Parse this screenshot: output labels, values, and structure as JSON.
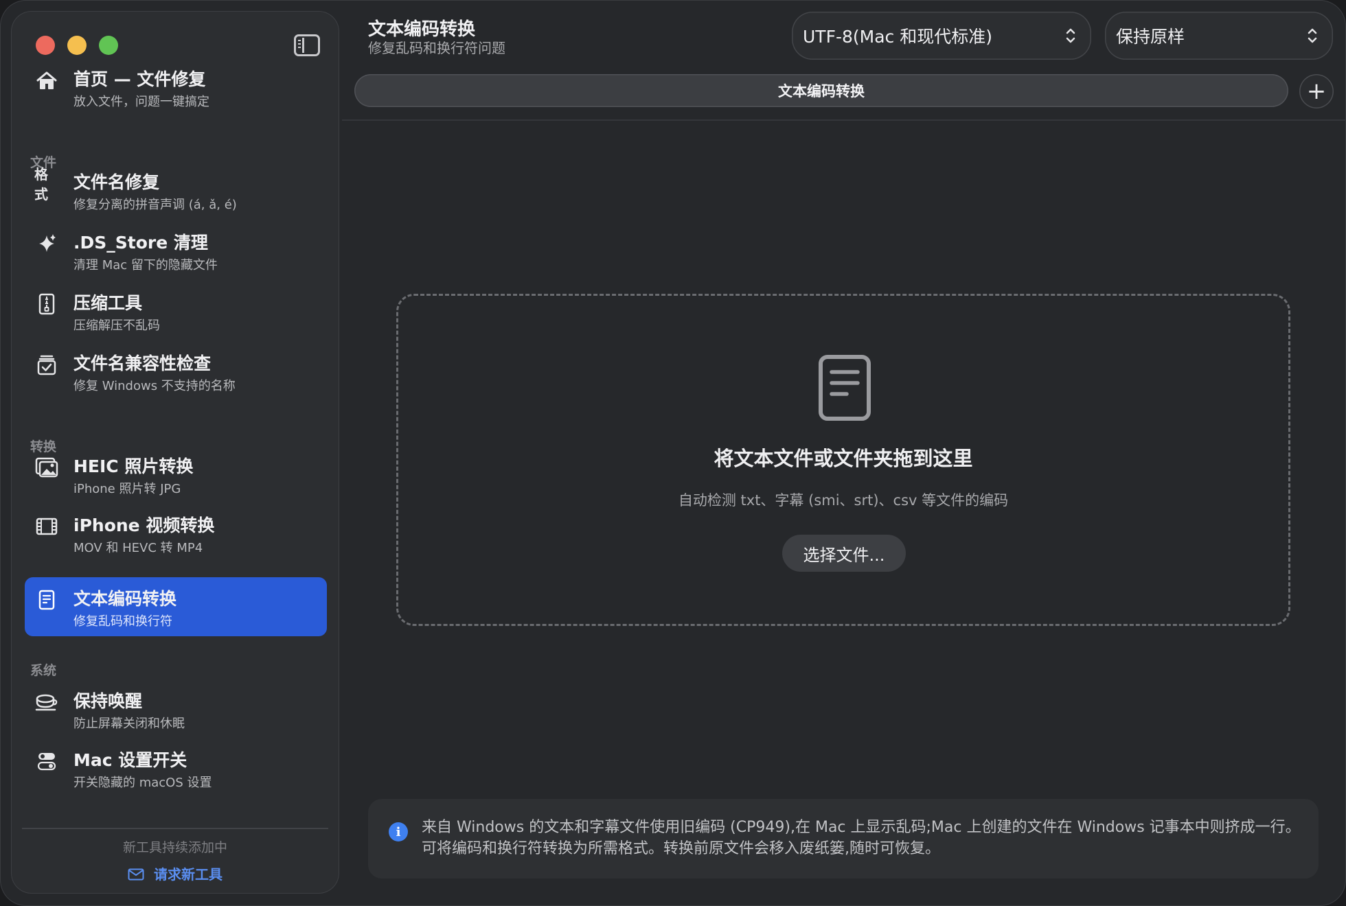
{
  "sidebar": {
    "sections": {
      "files": "文件",
      "convert": "转换",
      "system": "系统"
    },
    "items": [
      {
        "title": "首页 — 文件修复",
        "subtitle": "放入文件，问题一键搞定",
        "icon": "house-icon"
      },
      {
        "title": "文件名修复",
        "subtitle": "修复分离的拼音声调 (á, ǎ, é)",
        "icon": "format-icon",
        "icon_text": "格式"
      },
      {
        "title": ".DS_Store 清理",
        "subtitle": "清理 Mac 留下的隐藏文件",
        "icon": "sparkle-icon"
      },
      {
        "title": "压缩工具",
        "subtitle": "压缩解压不乱码",
        "icon": "zip-file-icon"
      },
      {
        "title": "文件名兼容性检查",
        "subtitle": "修复 Windows 不支持的名称",
        "icon": "checkbox-icon"
      },
      {
        "title": "HEIC 照片转换",
        "subtitle": "iPhone 照片转 JPG",
        "icon": "photo-icon"
      },
      {
        "title": "iPhone 视频转换",
        "subtitle": "MOV 和 HEVC 转 MP4",
        "icon": "film-icon"
      },
      {
        "title": "文本编码转换",
        "subtitle": "修复乱码和换行符",
        "icon": "document-icon",
        "active": true
      },
      {
        "title": "保持唤醒",
        "subtitle": "防止屏幕关闭和休眠",
        "icon": "coffee-cup-icon"
      },
      {
        "title": "Mac 设置开关",
        "subtitle": "开关隐藏的 macOS 设置",
        "icon": "toggle-icon"
      }
    ],
    "footer_text": "新工具持续添加中",
    "footer_link": "请求新工具"
  },
  "header": {
    "title": "文本编码转换",
    "subtitle": "修复乱码和换行符问题",
    "encoding_select": "UTF-8(Mac 和现代标准)",
    "linebreak_select": "保持原样",
    "tab_label": "文本编码转换",
    "add_tab": "+"
  },
  "dropzone": {
    "title": "将文本文件或文件夹拖到这里",
    "subtitle": "自动检测 txt、字幕 (smi、srt)、csv 等文件的编码",
    "button": "选择文件..."
  },
  "info": {
    "icon": "i",
    "text": "来自 Windows 的文本和字幕文件使用旧编码 (CP949),在 Mac 上显示乱码;Mac 上创建的文件在 Windows 记事本中则挤成一行。可将编码和换行符转换为所需格式。转换前原文件会移入废纸篓,随时可恢复。"
  },
  "colors": {
    "accent": "#2a5bd7",
    "link": "#5a8ef0",
    "info": "#3f80f0"
  }
}
